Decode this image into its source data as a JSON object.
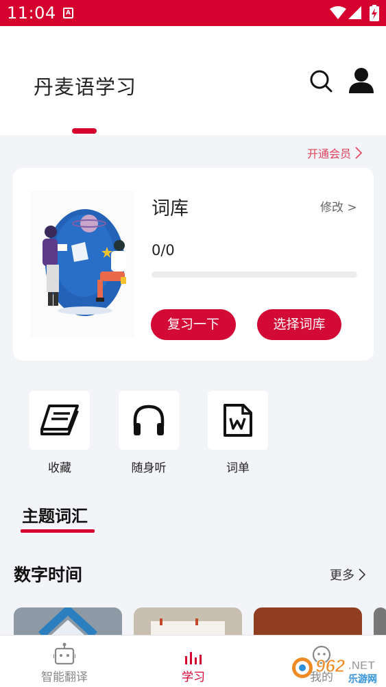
{
  "status_bar": {
    "time": "11:04",
    "a_badge": "A"
  },
  "header": {
    "title": "丹麦语学习"
  },
  "vip_link": "开通会员",
  "library_card": {
    "title": "词库",
    "edit_label": "修改 >",
    "progress_text": "0/0",
    "progress_fraction": 0,
    "review_button": "复习一下",
    "choose_button": "选择词库"
  },
  "shortcuts": [
    {
      "label": "收藏",
      "icon": "book-icon"
    },
    {
      "label": "随身听",
      "icon": "headphones-icon"
    },
    {
      "label": "词单",
      "icon": "word-document-icon"
    }
  ],
  "topic_tab": "主题词汇",
  "section": {
    "title": "数字时间",
    "more_label": "更多"
  },
  "bottom_nav": [
    {
      "label": "智能翻译",
      "icon": "robot-icon",
      "active": false
    },
    {
      "label": "学习",
      "icon": "bar-chart-icon",
      "active": true
    },
    {
      "label": "我的",
      "icon": "chat-face-icon",
      "active": false
    }
  ],
  "watermark": {
    "main": "962",
    "suffix": ".NET",
    "sub": "乐游网"
  },
  "colors": {
    "accent": "#d6002e",
    "vip_link": "#e2425b",
    "background": "#f3f4f7"
  }
}
